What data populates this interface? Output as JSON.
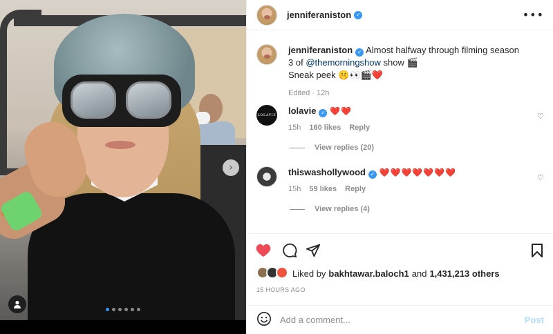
{
  "post": {
    "author": "jenniferaniston",
    "verified": true,
    "caption_text": "Almost halfway through filming season 3 of",
    "caption_mention": "@themorningshow",
    "caption_after": "show 🎬",
    "caption_line2": "Sneak peek 🤫👀🎬❤️",
    "edited_label": "Edited · 12h",
    "more_icon": "more-horizontal-icon"
  },
  "photo": {
    "carousel_total": 6,
    "carousel_active": 1,
    "next_icon": "chevron-right-icon",
    "tag_icon": "user-tag-icon"
  },
  "comments": [
    {
      "username": "lolavie",
      "verified": true,
      "text": "❤️❤️",
      "time": "15h",
      "likes": "160 likes",
      "reply": "Reply",
      "view_replies": "View replies (20)",
      "avatar_text": "LOLAVIE"
    },
    {
      "username": "thiswashollywood",
      "verified": true,
      "text": "❤️❤️❤️❤️❤️❤️❤️",
      "time": "15h",
      "likes": "59 likes",
      "reply": "Reply",
      "view_replies": "View replies (4)"
    }
  ],
  "actions": {
    "like_icon": "heart-filled-icon",
    "comment_icon": "comment-icon",
    "share_icon": "paper-plane-icon",
    "save_icon": "bookmark-icon",
    "like_color": "#ed4956"
  },
  "likes": {
    "prefix": "Liked by",
    "user": "bakhtawar.baloch1",
    "and": "and",
    "count": "1,431,213 others"
  },
  "time_ago": "15 HOURS AGO",
  "composer": {
    "emoji_icon": "emoji-smile-icon",
    "placeholder": "Add a comment...",
    "post_label": "Post"
  }
}
